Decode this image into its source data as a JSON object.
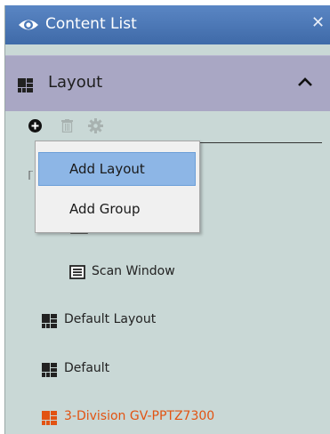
{
  "window": {
    "title": "Content List",
    "close_glyph": "✕"
  },
  "section": {
    "label": "Layout",
    "expanded": true
  },
  "toolbar": {
    "add_icon": "add-circle-icon",
    "delete_icon": "trash-icon",
    "settings_icon": "gear-icon"
  },
  "menu": {
    "items": [
      {
        "label": "Add Layout",
        "highlighted": true
      },
      {
        "label": "Add Group",
        "highlighted": false
      }
    ]
  },
  "tree": {
    "items": [
      {
        "label": "Scan Window",
        "icon": "scan-window-icon"
      },
      {
        "label": "Default Layout",
        "icon": "layout-grid-icon"
      },
      {
        "label": "Default",
        "icon": "layout-grid-icon"
      },
      {
        "label": "3-Division GV-PPTZ7300",
        "icon": "layout-grid-icon",
        "color": "#e25312"
      }
    ]
  },
  "colors": {
    "titlebar": "#4a78b8",
    "panel": "#c9d8d6",
    "section_header": "#a9a7c4",
    "menu_highlight": "#8db6e6",
    "accent_orange": "#e25312"
  }
}
